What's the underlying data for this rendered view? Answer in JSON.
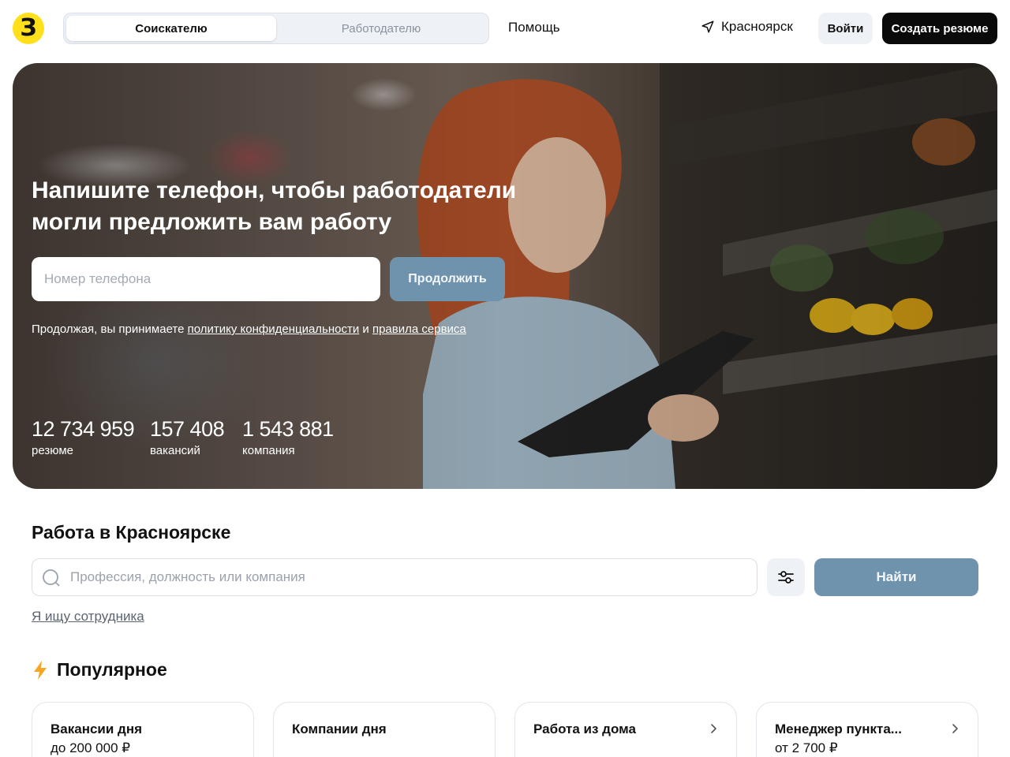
{
  "header": {
    "logo_letter": "З",
    "tabs": [
      {
        "label": "Соискателю",
        "active": true
      },
      {
        "label": "Работодателю",
        "active": false
      }
    ],
    "help": "Помощь",
    "city": "Красноярск",
    "login": "Войти",
    "create_resume": "Создать резюме"
  },
  "hero": {
    "title": "Напишите телефон, чтобы работодатели могли предложить вам работу",
    "phone_placeholder": "Номер телефона",
    "continue": "Продолжить",
    "consent_prefix": "Продолжая, вы принимаете ",
    "privacy_link": "политику конфиденциальности",
    "consent_and": " и ",
    "rules_link": "правила сервиса",
    "stats": [
      {
        "value": "12 734 959",
        "label": "резюме"
      },
      {
        "value": "157 408",
        "label": "вакансий"
      },
      {
        "value": "1 543 881",
        "label": "компания"
      }
    ]
  },
  "search": {
    "title": "Работа в Красноярске",
    "placeholder": "Профессия, должность или компания",
    "find": "Найти",
    "employer_link": "Я ищу сотрудника"
  },
  "popular": {
    "title": "Популярное",
    "cards": [
      {
        "title": "Вакансии дня",
        "subtitle": "до 200 000 ₽"
      },
      {
        "title": "Компании дня",
        "subtitle": ""
      },
      {
        "title": "Работа из дома",
        "subtitle": ""
      },
      {
        "title": "Менеджер пункта...",
        "subtitle": "от 2 700 ₽"
      }
    ]
  },
  "colors": {
    "brand_yellow": "#ffe01a",
    "primary_button": "#7093ad",
    "dark_button": "#0a0a0a",
    "lightning": "#f5a623"
  },
  "icons": [
    "location-arrow-icon",
    "search-icon",
    "filter-sliders-icon",
    "lightning-icon",
    "chevron-right-icon"
  ]
}
